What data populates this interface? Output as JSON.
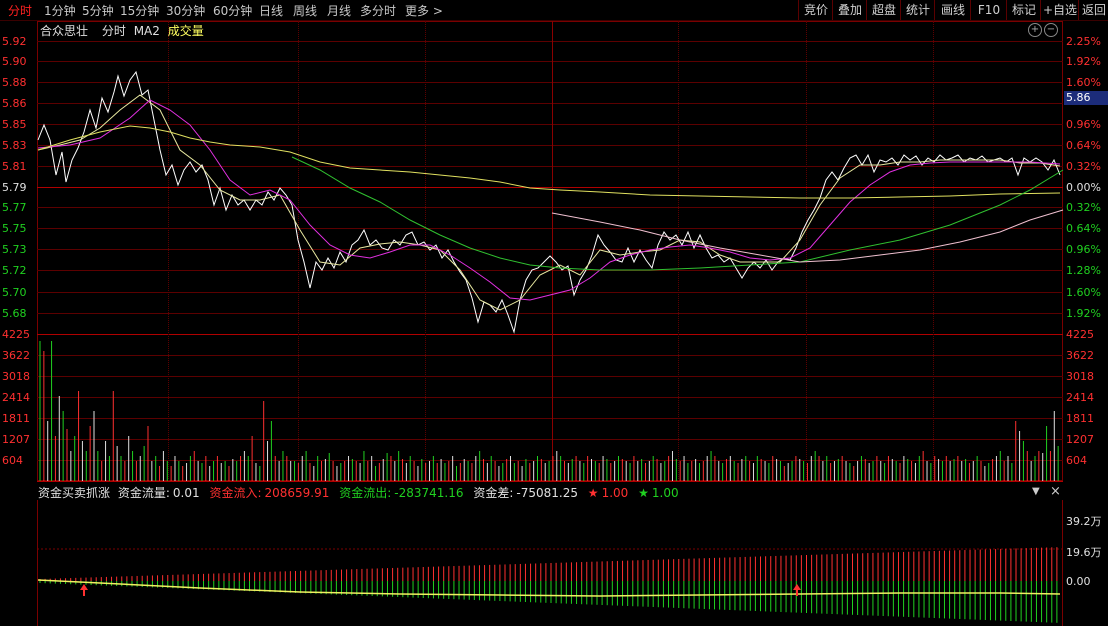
{
  "toolbar": {
    "periods": [
      {
        "label": "分时",
        "active": true
      },
      {
        "label": "1分钟"
      },
      {
        "label": "5分钟"
      },
      {
        "label": "15分钟"
      },
      {
        "label": "30分钟"
      },
      {
        "label": "60分钟"
      },
      {
        "label": "日线"
      },
      {
        "label": "周线"
      },
      {
        "label": "月线"
      },
      {
        "label": "多分时"
      },
      {
        "label": "更多 >"
      }
    ],
    "right_buttons": [
      "竞价",
      "叠加",
      "超盘",
      "统计",
      "画线",
      "F10",
      "标记",
      "+自选",
      "返回"
    ]
  },
  "chart_header": {
    "stock_name": "合众思壮",
    "mode": "分时",
    "indicator": "MA2",
    "volume_label": "成交量"
  },
  "price_axis": {
    "left_labels": [
      "5.92",
      "5.90",
      "5.88",
      "5.86",
      "5.85",
      "5.83",
      "5.81",
      "5.79",
      "5.77",
      "5.75",
      "5.73",
      "5.72",
      "5.70",
      "5.68"
    ],
    "right_labels": [
      "2.25%",
      "1.92%",
      "1.60%",
      "",
      "0.96%",
      "0.64%",
      "0.32%",
      "0.00%",
      "0.32%",
      "0.64%",
      "0.96%",
      "1.28%",
      "1.60%",
      "1.92%"
    ],
    "current_price": "5.86"
  },
  "volume_axis": {
    "labels": [
      "4225",
      "3622",
      "3018",
      "2414",
      "1811",
      "1207",
      "604"
    ]
  },
  "fund_panel": {
    "title": "资金买卖抓涨",
    "flow_label": "资金流量:",
    "flow_value": "0.01",
    "inflow_label": "资金流入:",
    "inflow_value": "208659.91",
    "outflow_label": "资金流出:",
    "outflow_value": "-283741.16",
    "diff_label": "资金差:",
    "diff_value": "-75081.25",
    "star_red": "1.00",
    "star_green": "1.00",
    "axis_labels": [
      "39.2万",
      "19.6万",
      "0.00"
    ],
    "icons": [
      "chevron-down-icon",
      "close-icon"
    ]
  },
  "colors": {
    "price_line": "#ffffff",
    "ma_yellow": "#ffff60",
    "ma_magenta": "#e030e0",
    "avg_green": "#30c030",
    "avg_yellow": "#e0e060",
    "avg_pink": "#f0c0d0",
    "up": "#ff3030",
    "down": "#20d020",
    "grid": "#5c0000"
  }
}
